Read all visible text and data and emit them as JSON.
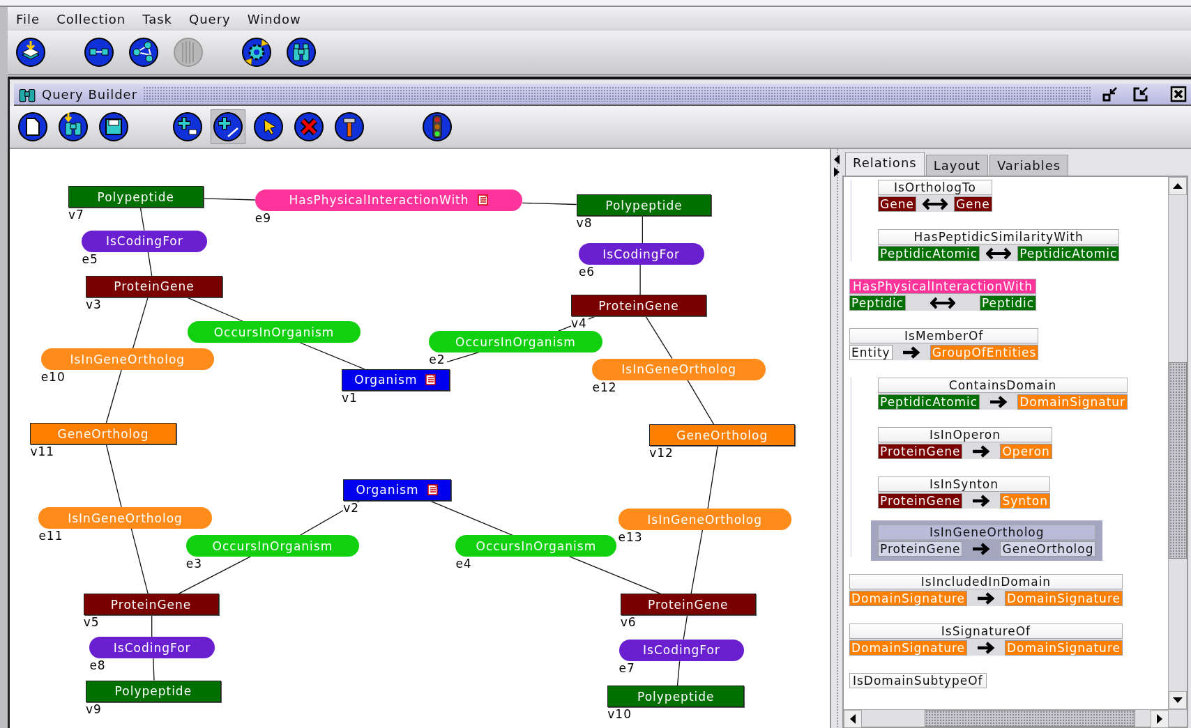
{
  "menu": [
    "File",
    "Collection",
    "Task",
    "Query",
    "Window"
  ],
  "main_toolbar": [
    {
      "kind": "import",
      "disabled": false
    },
    {
      "kind": "link",
      "disabled": false
    },
    {
      "kind": "graph",
      "disabled": false
    },
    {
      "kind": "database",
      "disabled": true
    },
    {
      "kind": "refresh",
      "disabled": false
    },
    {
      "kind": "binoculars",
      "disabled": false
    }
  ],
  "query_window": {
    "title": "Query Builder",
    "toolbar": [
      {
        "kind": "new",
        "selected": false
      },
      {
        "kind": "open",
        "selected": false
      },
      {
        "kind": "save",
        "selected": false
      },
      {
        "kind": "add-node",
        "selected": false
      },
      {
        "kind": "add-edge",
        "selected": true
      },
      {
        "kind": "pointer",
        "selected": false
      },
      {
        "kind": "delete",
        "selected": false
      },
      {
        "kind": "tools",
        "selected": false
      },
      {
        "kind": "run",
        "selected": false
      }
    ],
    "diagram": {
      "vertices": [
        {
          "label": "Polypeptide",
          "id": "v7",
          "color": "#007000",
          "annotated": false
        },
        {
          "label": "Polypeptide",
          "id": "v8",
          "color": "#007000",
          "annotated": false
        },
        {
          "label": "ProteinGene",
          "id": "v3",
          "color": "#7a0000",
          "annotated": false
        },
        {
          "label": "ProteinGene",
          "id": "v4",
          "color": "#7a0000",
          "annotated": false
        },
        {
          "label": "Organism",
          "id": "v1",
          "color": "#0000ee",
          "annotated": true
        },
        {
          "label": "GeneOrtholog",
          "id": "v11",
          "color": "#ff8000",
          "annotated": false
        },
        {
          "label": "GeneOrtholog",
          "id": "v12",
          "color": "#ff8000",
          "annotated": false
        },
        {
          "label": "Organism",
          "id": "v2",
          "color": "#0000ee",
          "annotated": true
        },
        {
          "label": "ProteinGene",
          "id": "v5",
          "color": "#7a0000",
          "annotated": false
        },
        {
          "label": "ProteinGene",
          "id": "v6",
          "color": "#7a0000",
          "annotated": false
        },
        {
          "label": "Polypeptide",
          "id": "v9",
          "color": "#007000",
          "annotated": false
        },
        {
          "label": "Polypeptide",
          "id": "v10",
          "color": "#007000",
          "annotated": false
        }
      ],
      "edges": [
        {
          "label": "HasPhysicalInteractionWith",
          "id": "e9",
          "color": "#ff3399",
          "annotated": true
        },
        {
          "label": "IsCodingFor",
          "id": "e5",
          "color": "#6a1fd0",
          "annotated": false
        },
        {
          "label": "IsCodingFor",
          "id": "e6",
          "color": "#6a1fd0",
          "annotated": false
        },
        {
          "label": "OccursInOrganism",
          "color": "#10d010",
          "annotated": false
        },
        {
          "label": "OccursInOrganism",
          "id": "e2",
          "color": "#10d010",
          "annotated": false
        },
        {
          "label": "IsInGeneOrtholog",
          "id": "e10",
          "color": "#ff8c1a",
          "annotated": false
        },
        {
          "label": "IsInGeneOrtholog",
          "id": "e12",
          "color": "#ff8c1a",
          "annotated": false
        },
        {
          "label": "IsInGeneOrtholog",
          "id": "e11",
          "color": "#ff8c1a",
          "annotated": false
        },
        {
          "label": "IsInGeneOrtholog",
          "id": "e13",
          "color": "#ff8c1a",
          "annotated": false
        },
        {
          "label": "OccursInOrganism",
          "id": "e3",
          "color": "#10d010",
          "annotated": false
        },
        {
          "label": "OccursInOrganism",
          "id": "e4",
          "color": "#10d010",
          "annotated": false
        },
        {
          "label": "IsCodingFor",
          "id": "e8",
          "color": "#6a1fd0",
          "annotated": false
        },
        {
          "label": "IsCodingFor",
          "id": "e7",
          "color": "#6a1fd0",
          "annotated": false
        }
      ]
    },
    "side_panel": {
      "tabs": [
        {
          "label": "Relations",
          "selected": true
        },
        {
          "label": "Layout",
          "selected": false
        },
        {
          "label": "Variables",
          "selected": false
        }
      ],
      "relations": [
        {
          "children": [
            {
              "name": "IsOrthologTo",
              "selected": false,
              "kind": "bidirectional",
              "left": {
                "label": "Gene",
                "color": "#7a0000"
              },
              "right": {
                "label": "Gene",
                "color": "#7a0000"
              }
            },
            {
              "name": "HasPeptidicSimilarityWith",
              "selected": false,
              "kind": "bidirectional",
              "left": {
                "label": "PeptidicAtomic",
                "color": "#007000"
              },
              "right": {
                "label": "PeptidicAtomic",
                "color": "#007000"
              }
            }
          ]
        },
        {
          "name": "HasPhysicalInteractionWith",
          "color": "#ff3399",
          "selected": false,
          "kind": "bidirectional",
          "left": {
            "label": "Peptidic",
            "color": "#007000"
          },
          "right": {
            "label": "Peptidic",
            "color": "#007000"
          }
        },
        {
          "name": "IsMemberOf",
          "selected": false,
          "kind": "directed",
          "left": {
            "label": "Entity",
            "color": "#ffffff"
          },
          "right": {
            "label": "GroupOfEntities",
            "color": "#ff8000"
          },
          "children": [
            {
              "name": "ContainsDomain",
              "selected": false,
              "kind": "directed",
              "left": {
                "label": "PeptidicAtomic",
                "color": "#007000"
              },
              "right": {
                "label": "DomainSignatur",
                "color": "#ff8000"
              }
            },
            {
              "name": "IsInOperon",
              "selected": false,
              "kind": "directed",
              "left": {
                "label": "ProteinGene",
                "color": "#7a0000"
              },
              "right": {
                "label": "Operon",
                "color": "#ff8000"
              }
            },
            {
              "name": "IsInSynton",
              "selected": false,
              "kind": "directed",
              "left": {
                "label": "ProteinGene",
                "color": "#7a0000"
              },
              "right": {
                "label": "Synton",
                "color": "#ff8000"
              }
            },
            {
              "name": "IsInGeneOrtholog",
              "selected": true,
              "kind": "directed",
              "left": {
                "label": "ProteinGene",
                "color": "#d4d7ea"
              },
              "right": {
                "label": "GeneOrtholog",
                "color": "#d4d7ea"
              }
            }
          ]
        },
        {
          "name": "IsIncludedInDomain",
          "selected": false,
          "kind": "directed",
          "left": {
            "label": "DomainSignature",
            "color": "#ff8000"
          },
          "right": {
            "label": "DomainSignature",
            "color": "#ff8000"
          }
        },
        {
          "name": "IsSignatureOf",
          "selected": false,
          "kind": "directed",
          "left": {
            "label": "DomainSignature",
            "color": "#ff8000"
          },
          "right": {
            "label": "DomainSignature",
            "color": "#ff8000"
          }
        },
        {
          "name": "IsDomainSubtypeOf",
          "selected": false
        }
      ]
    }
  }
}
